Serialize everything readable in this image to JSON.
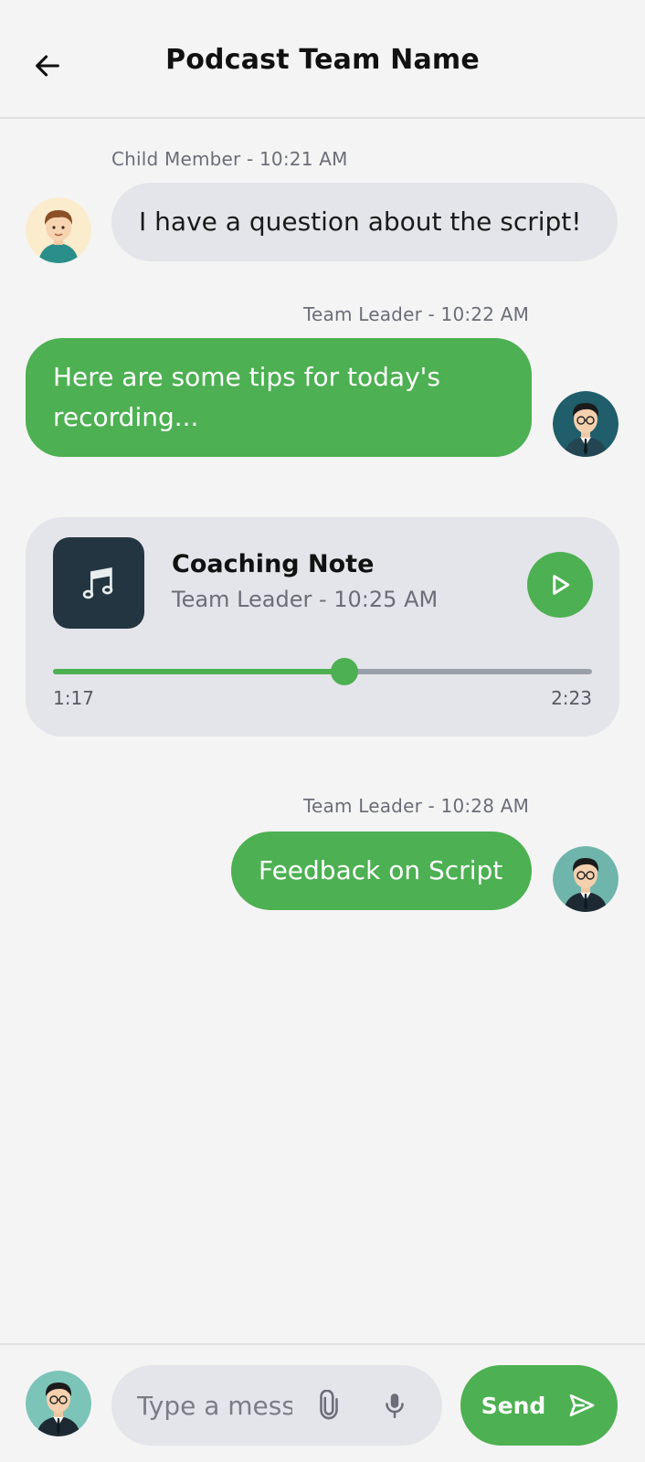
{
  "header": {
    "title": "Podcast Team Name",
    "back_icon": "arrow-left-icon"
  },
  "messages": [
    {
      "meta": "Child Member - 10:21 AM",
      "text": "I have a question about the script!",
      "avatar": "child-avatar"
    },
    {
      "meta": "Team Leader - 10:22 AM",
      "text": "Here are some tips for today's recording...",
      "avatar": "team-leader-avatar"
    },
    {
      "meta": "Team Leader - 10:28 AM",
      "text": "Feedback on Script",
      "avatar": "team-leader-avatar"
    }
  ],
  "audio_note": {
    "title": "Coaching Note",
    "subtitle": "Team Leader - 10:25 AM",
    "current_time": "1:17",
    "total_time": "2:23",
    "progress_fraction": 0.54,
    "thumb_icon": "music-note-icon",
    "play_icon": "play-icon"
  },
  "composer": {
    "placeholder": "Type a message...",
    "attach_icon": "paperclip-icon",
    "mic_icon": "microphone-icon",
    "send_label": "Send",
    "send_icon": "send-icon"
  },
  "colors": {
    "accent": "#4db052",
    "bubble_grey": "#e4e5ea",
    "background": "#f4f4f4"
  }
}
